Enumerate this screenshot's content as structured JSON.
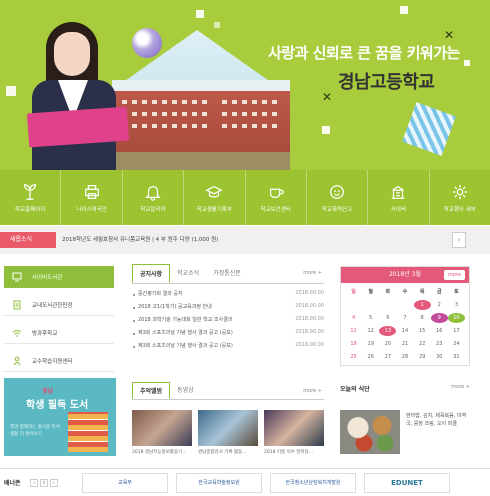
{
  "hero": {
    "slogan": "사랑과 신뢰로 큰 꿈을 키워가는",
    "school_name": "경남고등학교"
  },
  "menu": [
    {
      "label": "학교홈페이지",
      "icon": "plant-icon"
    },
    {
      "label": "나이스대국민",
      "icon": "printer-icon"
    },
    {
      "label": "학교알리미",
      "icon": "bell-icon"
    },
    {
      "label": "학교생활기록부",
      "icon": "graduation-cap-icon"
    },
    {
      "label": "학교보건센터",
      "icon": "cup-icon"
    },
    {
      "label": "학교폭력신고",
      "icon": "face-icon"
    },
    {
      "label": "사이버",
      "icon": "building-icon"
    },
    {
      "label": "학교행사 세부",
      "icon": "gear-icon"
    }
  ],
  "notice": {
    "tag": "새롭소식",
    "text": "2018학년도 세월호참사 유니폼교육원 | 4 부 원주 다양 (1,000 원)",
    "more": "›"
  },
  "quick_links": [
    {
      "label": "사이버도서관",
      "icon": "monitor-icon",
      "active": true
    },
    {
      "label": "교내도서관한민정",
      "icon": "clipboard-icon",
      "active": false
    },
    {
      "label": "방과후학교",
      "icon": "wifi-icon",
      "active": false
    },
    {
      "label": "교수학습지원센터",
      "icon": "person-icon",
      "active": false
    }
  ],
  "board": {
    "tabs": [
      "공지사항",
      "학교소식",
      "가정통신문"
    ],
    "more": "more +",
    "posts": [
      {
        "title": "중간평가회 결과 공지",
        "date": "2018.00.00"
      },
      {
        "title": "2018 고1(1학기) 공교육과정 안내",
        "date": "2018.00.00"
      },
      {
        "title": "2018 과학기술 기능대회 일반 학교 조사결과",
        "date": "2018.00.00"
      },
      {
        "title": "제3회 스포츠의날 기념 행사 결과 공고 (공보)",
        "date": "2018.00.00"
      },
      {
        "title": "제3회 스포츠의날 기념 행사 결과 공고 (공보)",
        "date": "2018.00.00"
      }
    ]
  },
  "calendar": {
    "title": "2018년 3월",
    "more": "more",
    "weekdays": [
      "일",
      "월",
      "화",
      "수",
      "목",
      "금",
      "토"
    ],
    "days": [
      "",
      "",
      "",
      "",
      "1",
      "2",
      "3",
      "4",
      "5",
      "6",
      "7",
      "8",
      "9",
      "10",
      "11",
      "12",
      "13",
      "14",
      "15",
      "16",
      "17",
      "18",
      "19",
      "20",
      "21",
      "22",
      "23",
      "24",
      "25",
      "26",
      "27",
      "28",
      "29",
      "30",
      "31"
    ]
  },
  "promo": {
    "line1": "경남",
    "line2": "학생 필독 도서",
    "line3": "책과 함께하는 즐거운 독서 생활 더 알아보기"
  },
  "photo": {
    "tabs": [
      "추억앨범",
      "동영상"
    ],
    "more": "more +",
    "items": [
      {
        "caption": "2018 경남지능정보활용기..."
      },
      {
        "caption": "경남종합감사 기록 활동..."
      },
      {
        "caption": "2018 이름 이수 한마당..."
      }
    ]
  },
  "meal": {
    "title": "오늘의 식단",
    "more": "more +",
    "menu": "현미밥, 김치, 제육볶음, 미역국, 콩장 조림, 오이 피클"
  },
  "banner": {
    "label": "배너존",
    "items": [
      "교육부",
      "한국교육학술정보원",
      "한국청소년상담복지개발원",
      "EDUNET"
    ]
  }
}
